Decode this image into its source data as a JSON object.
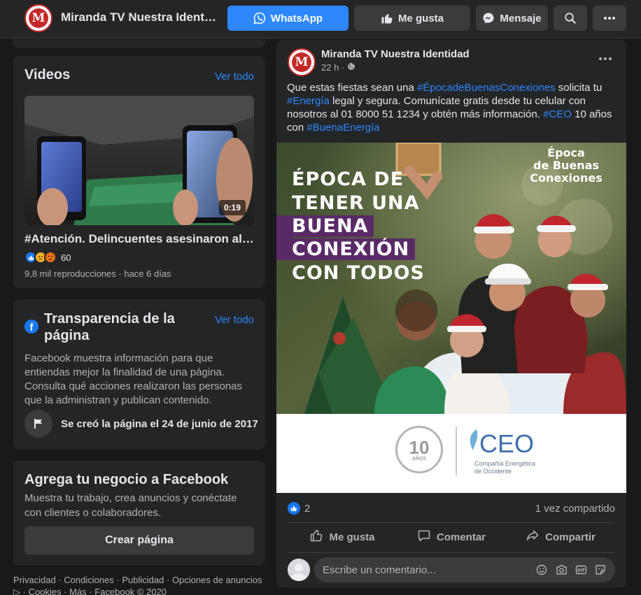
{
  "header": {
    "page_name": "Miranda TV Nuestra Identidad",
    "whatsapp_label": "WhatsApp",
    "like_label": "Me gusta",
    "message_label": "Mensaje",
    "logo_letter": "M"
  },
  "videos": {
    "title": "Videos",
    "see_all": "Ver todo",
    "item": {
      "duration": "0:19",
      "title": "#Atención. Delincuentes asesinaron al C...",
      "reaction_count": "60",
      "meta": "9,8 mil reproducciones · hace 6 días"
    }
  },
  "transparency": {
    "title": "Transparencia de la página",
    "see_all": "Ver todo",
    "body": "Facebook muestra información para que entiendas mejor la finalidad de una página. Consulta qué acciones realizaron las personas que la administran y publican contenido.",
    "created": "Se creó la página el 24 de junio de 2017"
  },
  "business": {
    "title": "Agrega tu negocio a Facebook",
    "body": "Muestra tu trabajo, crea anuncios y conéctate con clientes o colaboradores.",
    "button": "Crear página"
  },
  "footer": {
    "links": [
      "Privacidad",
      "Condiciones",
      "Publicidad",
      "Opciones de anuncios"
    ],
    "line2": [
      "Cookies",
      "Más",
      "Facebook © 2020"
    ]
  },
  "post": {
    "author": "Miranda TV Nuestra Identidad",
    "time": "22 h ·",
    "text": {
      "p1": "Que estas fiestas sean una ",
      "tag1": "#ÉpocadeBuenasConexiones",
      "p2": " solicita tu ",
      "tag2": "#Energía",
      "p3": " legal y segura. Comunícate gratis desde tu celular con nosotros al 01 8000 51 1234 y obtén más información. ",
      "tag3": "#CEO",
      "p4": " 10 años con ",
      "tag4": "#BuenaEnergía"
    },
    "image": {
      "headline": [
        "ÉPOCA DE",
        "TENER UNA",
        "BUENA",
        "CONEXIÓN",
        "CON TODOS"
      ],
      "campaign_logo": [
        "Época",
        "de Buenas",
        "Conexiones"
      ],
      "seal_number": "10",
      "seal_sub": "AÑOS",
      "brand": "CEO",
      "brand_sub": [
        "Compañía Energética",
        "de Occidente"
      ]
    },
    "likes": "2",
    "shares": "1 vez compartido",
    "actions": {
      "like": "Me gusta",
      "comment": "Comentar",
      "share": "Compartir"
    },
    "comment_placeholder": "Escribe un comentario..."
  },
  "colors": {
    "background": "#18191a",
    "surface": "#242526",
    "accent": "#2d88ff",
    "brand_red": "#c62828",
    "headline_purple": "#5a2a67"
  }
}
